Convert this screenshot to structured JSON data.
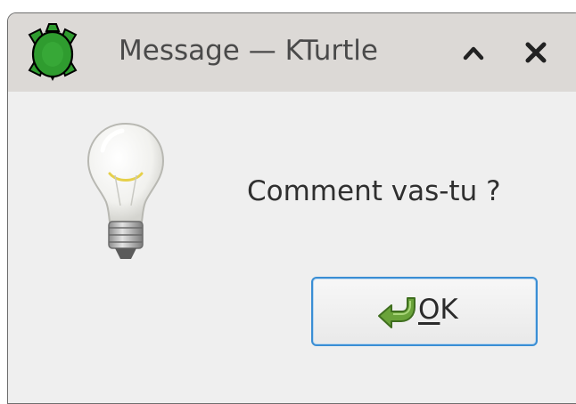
{
  "window": {
    "title": "Message — KTurtle",
    "app_icon": "kturtle-turtle-icon",
    "buttons": {
      "minimize_icon": "chevron-up-icon",
      "close_icon": "close-icon"
    }
  },
  "dialog": {
    "icon": "lightbulb-icon",
    "message": "Comment vas-tu ?",
    "ok_button": {
      "icon": "ok-arrow-icon",
      "mnemonic": "O",
      "rest": "K"
    }
  },
  "colors": {
    "titlebar_bg": "#dcd9d6",
    "dialog_bg": "#efefef",
    "button_focus_border": "#3a8ed4",
    "turtle_green": "#2f9c2f"
  }
}
